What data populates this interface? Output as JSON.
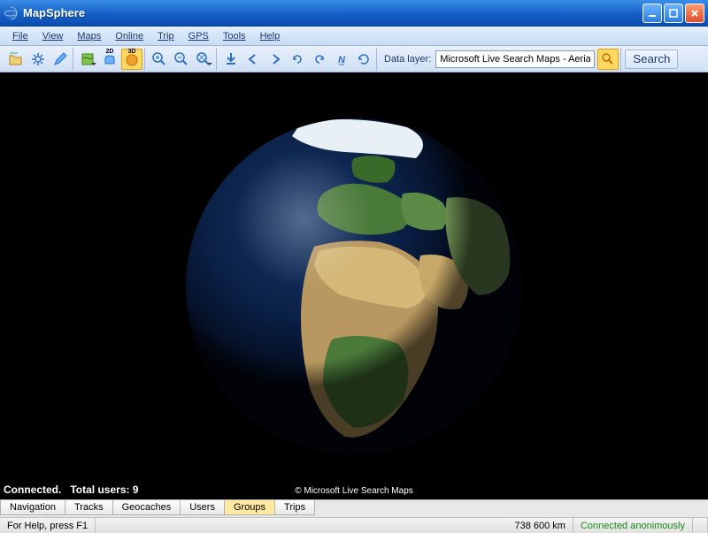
{
  "title": "MapSphere",
  "menu": {
    "items": [
      "File",
      "View",
      "Maps",
      "Online",
      "Trip",
      "GPS",
      "Tools",
      "Help"
    ]
  },
  "toolbar": {
    "mode2d": "2D",
    "mode3d": "3D",
    "datalayer_label": "Data layer:",
    "datalayer_value": "Microsoft Live Search Maps - Aerial",
    "search_label": "Search"
  },
  "viewport": {
    "connected_label": "Connected.",
    "users_label": "Total users: 9",
    "copyright": "© Microsoft Live Search Maps"
  },
  "tabs": {
    "items": [
      "Navigation",
      "Tracks",
      "Geocaches",
      "Users",
      "Groups",
      "Trips"
    ],
    "active_index": 4
  },
  "statusbar": {
    "help": "For Help, press F1",
    "distance": "738 600 km",
    "connection": "Connected anonimously"
  }
}
